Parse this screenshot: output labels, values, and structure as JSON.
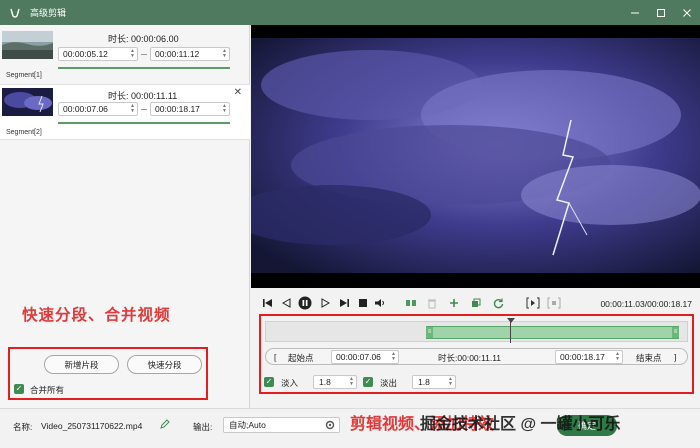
{
  "window": {
    "title": "高级剪辑",
    "controls": [
      "minimize-icon",
      "maximize-icon",
      "close-icon"
    ]
  },
  "segments": [
    {
      "label": "Segment[1]",
      "duration_label": "时长:",
      "duration": "00:00:06.00",
      "start": "00:00:05.12",
      "end": "00:00:11.12",
      "selected": false
    },
    {
      "label": "Segment[2]",
      "duration_label": "时长:",
      "duration": "00:00:11.11",
      "start": "00:00:07.06",
      "end": "00:00:18.17",
      "selected": true
    }
  ],
  "left_panel": {
    "caption": "快速分段、合并视频",
    "add_segment": "新增片段",
    "quick_split": "快速分段",
    "merge_all": "合并所有",
    "merge_all_checked": true
  },
  "player": {
    "time_display": "00:00:11.03/00:00:18.17",
    "icons": [
      "goto-start-icon",
      "prev-frame-icon",
      "pause-icon",
      "next-frame-icon",
      "stop-icon",
      "volume-icon",
      "split-icon",
      "delete-icon",
      "add-icon",
      "copy-icon",
      "reset-icon",
      "mark-in-icon",
      "mark-out-icon"
    ]
  },
  "trim": {
    "selection_start_fraction": 0.38,
    "selection_end_fraction": 0.98,
    "playhead_fraction": 0.58,
    "start_bracket": "[",
    "start_label": "起始点",
    "start_value": "00:00:07.06",
    "duration_label": "时长:",
    "duration_value": "00:00:11.11",
    "end_value": "00:00:18.17",
    "end_label": "结束点",
    "end_bracket": "]",
    "fade_in_label": "淡入",
    "fade_in_value": "1.8",
    "fade_in_checked": true,
    "fade_out_label": "淡出",
    "fade_out_value": "1.8",
    "fade_out_checked": true
  },
  "footer": {
    "name_label": "名称:",
    "file_name": "Video_250731170622.mp4",
    "output_label": "输出:",
    "output_value": "自动;Auto",
    "ok_label": "确定"
  },
  "overlay_text": {
    "bottom_caption": "剪辑视频、添加特效",
    "watermark": "掘金技术社区 @ 一罐小可乐"
  },
  "colors": {
    "titlebar": "#4f7a5f",
    "accent_green": "#5a9b67",
    "caption_red": "#e23a3a"
  }
}
